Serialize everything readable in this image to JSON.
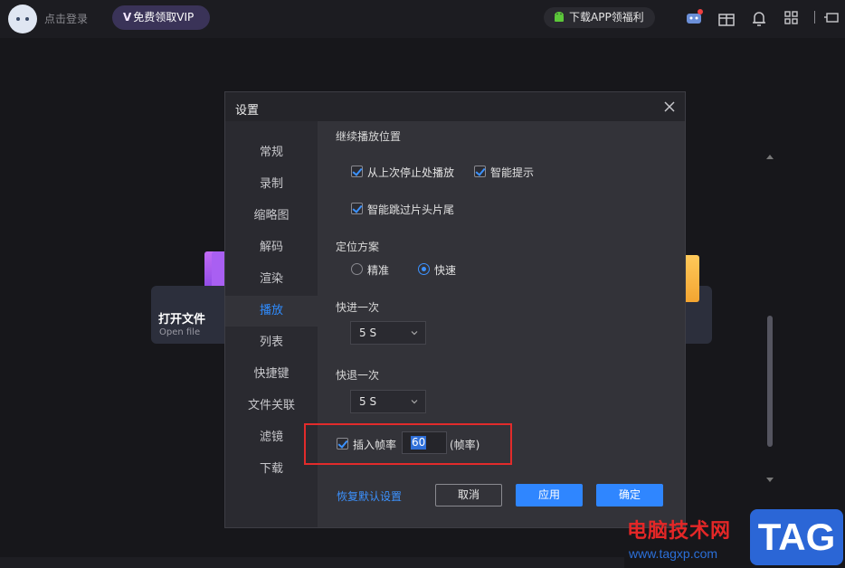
{
  "topbar": {
    "login_text": "点击登录",
    "vip_label": "免费领取VIP",
    "vip_mark": "V",
    "app_label": "下载APP领福利",
    "icons": [
      "controller-icon",
      "gift-icon",
      "bell-icon",
      "grid-icon",
      "minimize-icon"
    ]
  },
  "background": {
    "open_file_title": "打开文件",
    "open_file_subtitle": "Open file"
  },
  "dialog": {
    "title": "设置",
    "nav": [
      "常规",
      "录制",
      "缩略图",
      "解码",
      "渲染",
      "播放",
      "列表",
      "快捷键",
      "文件关联",
      "滤镜",
      "下载"
    ],
    "active_nav": "播放",
    "resume": {
      "label": "继续播放位置",
      "option1": "从上次停止处播放",
      "option1_checked": true,
      "option2": "智能提示",
      "option2_checked": true,
      "option3": "智能跳过片头片尾",
      "option3_checked": true
    },
    "seek": {
      "label": "定位方案",
      "option_precise": "精准",
      "option_fast": "快速",
      "selected": "快速"
    },
    "forward": {
      "label": "快进一次",
      "value": "5 S"
    },
    "backward": {
      "label": "快退一次",
      "value": "5 S"
    },
    "interpolate": {
      "label": "插入帧率",
      "checked": true,
      "value": "60",
      "unit": "(帧率)"
    },
    "reset_label": "恢复默认设置",
    "cancel_label": "取消",
    "apply_label": "应用",
    "ok_label": "确定"
  },
  "watermark": {
    "text": "电脑技术网",
    "url": "www.tagxp.com",
    "tag": "TAG"
  },
  "colors": {
    "accent": "#2f86ff",
    "highlight_box": "#e22b2b"
  }
}
